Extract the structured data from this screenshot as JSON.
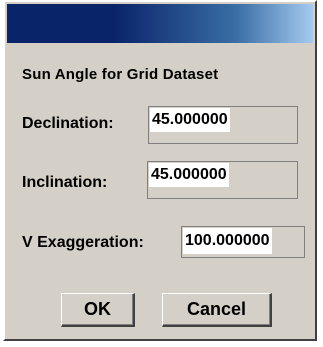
{
  "dialog": {
    "heading": "Sun Angle for Grid Dataset",
    "fields": [
      {
        "label": "Declination:",
        "value": "45.000000"
      },
      {
        "label": "Inclination:",
        "value": "45.000000"
      },
      {
        "label": "V Exaggeration:",
        "value": "100.000000"
      }
    ],
    "buttons": {
      "ok": "OK",
      "cancel": "Cancel"
    }
  },
  "colors": {
    "title_bar_start": "#0a246a",
    "title_bar_end": "#a6caf0",
    "dialog_face": "#d4d0c8"
  }
}
